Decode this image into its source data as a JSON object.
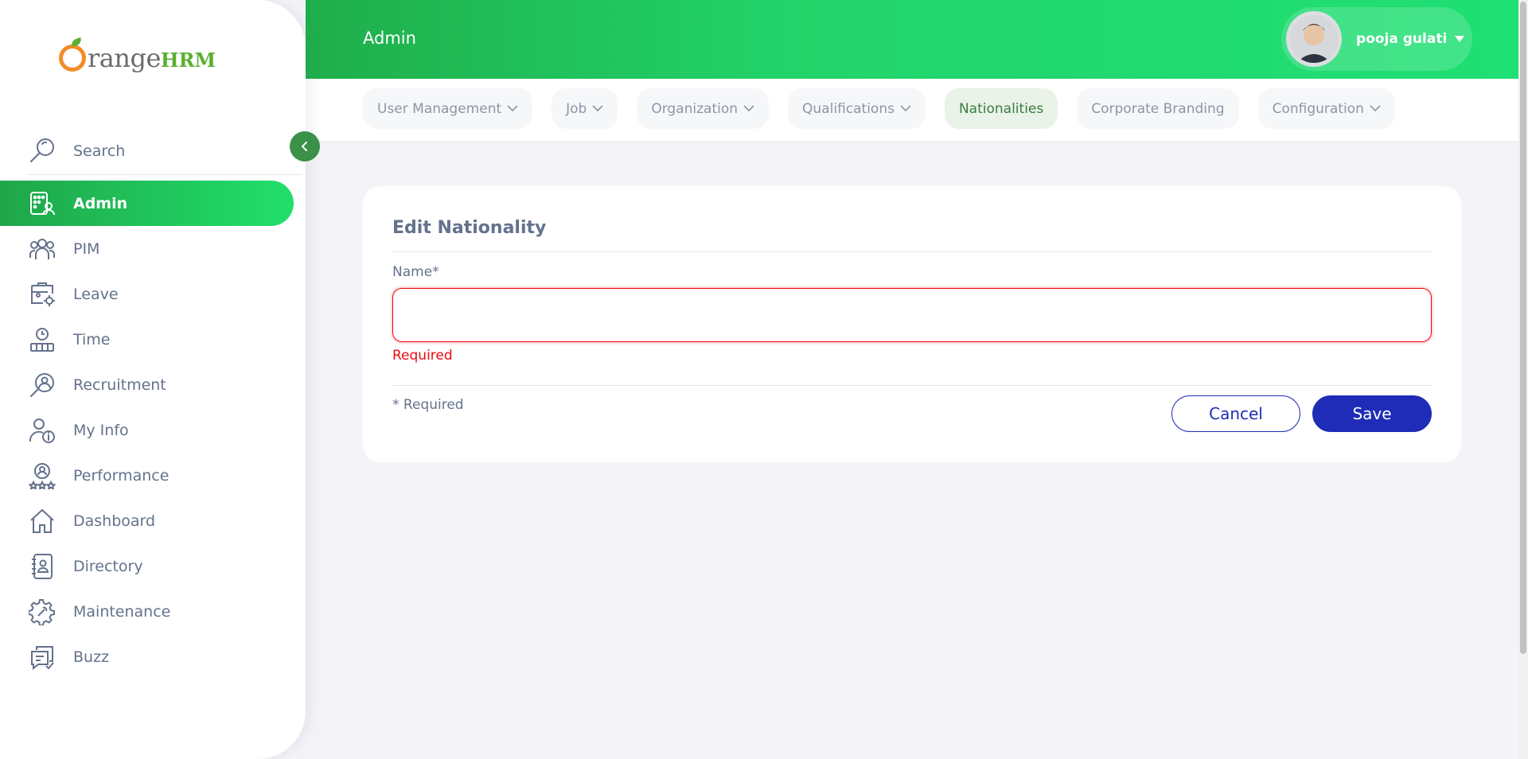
{
  "brand": {
    "logo_text_a": "rangeHRM",
    "logo_text_b": "HRM",
    "logo_word": "range"
  },
  "sidebar": {
    "search_placeholder": "Search",
    "items": [
      {
        "label": "Admin",
        "icon": "admin-icon",
        "active": true
      },
      {
        "label": "PIM",
        "icon": "pim-icon"
      },
      {
        "label": "Leave",
        "icon": "leave-icon"
      },
      {
        "label": "Time",
        "icon": "time-icon"
      },
      {
        "label": "Recruitment",
        "icon": "recruitment-icon"
      },
      {
        "label": "My Info",
        "icon": "my-info-icon"
      },
      {
        "label": "Performance",
        "icon": "performance-icon"
      },
      {
        "label": "Dashboard",
        "icon": "dashboard-icon"
      },
      {
        "label": "Directory",
        "icon": "directory-icon"
      },
      {
        "label": "Maintenance",
        "icon": "maintenance-icon"
      },
      {
        "label": "Buzz",
        "icon": "buzz-icon"
      }
    ]
  },
  "header": {
    "title": "Admin",
    "user_name": "pooja gulati"
  },
  "subnav": {
    "tabs": [
      {
        "label": "User Management",
        "has_dropdown": true
      },
      {
        "label": "Job",
        "has_dropdown": true
      },
      {
        "label": "Organization",
        "has_dropdown": true
      },
      {
        "label": "Qualifications",
        "has_dropdown": true
      },
      {
        "label": "Nationalities",
        "has_dropdown": false,
        "active": true
      },
      {
        "label": "Corporate Branding",
        "has_dropdown": false
      },
      {
        "label": "Configuration",
        "has_dropdown": true
      }
    ]
  },
  "form": {
    "title": "Edit Nationality",
    "name_label": "Name*",
    "name_value": "",
    "error": "Required",
    "required_note": "* Required",
    "cancel_label": "Cancel",
    "save_label": "Save"
  },
  "colors": {
    "brand_green": "#22d36a",
    "active_tab_bg": "#e9f3e7",
    "primary_blue": "#1f2cb7",
    "error_red": "#eb0910",
    "text_gray": "#64728c"
  }
}
